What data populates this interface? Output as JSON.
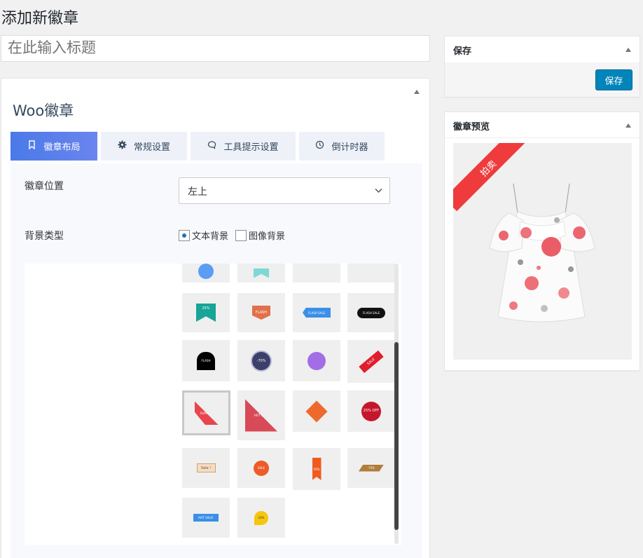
{
  "page": {
    "title": "添加新徽章"
  },
  "title_input": {
    "placeholder": "在此输入标题"
  },
  "main": {
    "heading": "Woo徽章",
    "tabs": [
      {
        "label": "徽章布局",
        "icon": "bookmark-icon",
        "active": true
      },
      {
        "label": "常规设置",
        "icon": "gear-icon",
        "active": false
      },
      {
        "label": "工具提示设置",
        "icon": "speech-bubble-icon",
        "active": false
      },
      {
        "label": "倒计时器",
        "icon": "clock-icon",
        "active": false
      }
    ],
    "position": {
      "label": "徽章位置",
      "value": "左上"
    },
    "bg_type": {
      "label": "背景类型",
      "options": [
        {
          "label": "文本背景",
          "checked": true
        },
        {
          "label": "图像背景",
          "checked": false
        }
      ]
    },
    "badges": [
      {
        "text": "25%"
      },
      {
        "text": "FLASH"
      },
      {
        "text": "FLASH SALE"
      },
      {
        "text": "FLASH SALE"
      },
      {
        "text": "FLASH"
      },
      {
        "text": "-70%"
      },
      {
        "text": ""
      },
      {
        "text": "SALE"
      },
      {
        "text": "SUMMER"
      },
      {
        "text": "HOT SALE"
      },
      {
        "text": ""
      },
      {
        "text": "25% OFF"
      },
      {
        "text": "Sale !"
      },
      {
        "text": "SALE"
      },
      {
        "text": "50%"
      },
      {
        "text": "-70%"
      },
      {
        "text": "HOT SALE!"
      },
      {
        "text": "20%"
      }
    ]
  },
  "save_box": {
    "title": "保存",
    "button": "保存"
  },
  "preview_box": {
    "title": "徽章预览",
    "ribbon": "拍卖"
  },
  "colors": {
    "accent": "#0085ba",
    "tab_active_start": "#4a7ae8",
    "ribbon": "#ef3b3b"
  }
}
